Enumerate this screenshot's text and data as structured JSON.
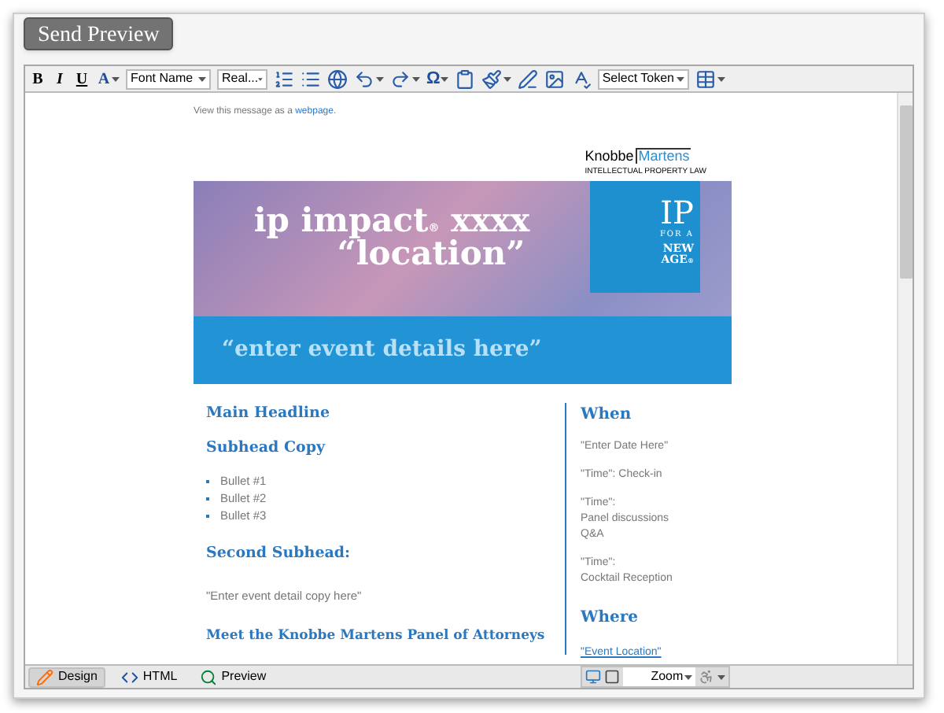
{
  "send_button": "Send Preview",
  "toolbar": {
    "format_buttons": [
      {
        "label": "B",
        "kind": "bold"
      },
      {
        "label": "I",
        "kind": "italic"
      },
      {
        "label": "U",
        "kind": "underline"
      },
      {
        "label": "A",
        "kind": "color"
      }
    ],
    "font_name": "Font Name",
    "font_size": "Real...",
    "symbol": "Ω",
    "token": "Select Token"
  },
  "email": {
    "view_text": "View this message as a ",
    "view_link": "webpage",
    "view_end": ".",
    "logo": {
      "left": "Knobbe",
      "right": "Martens",
      "tagline": "INTELLECTUAL PROPERTY LAW"
    },
    "banner": {
      "title": "ip impact",
      "reg": "®",
      "title_rest": " xxxx",
      "location": "“location”",
      "badge": [
        "IP",
        "FOR A",
        "NEW",
        "AGE"
      ],
      "badge_mark": "®",
      "details": "“enter event details here”"
    },
    "left": {
      "headline": "Main Headline",
      "subhead": "Subhead Copy",
      "bullets": [
        "Bullet #1",
        "Bullet #2",
        "Bullet #3"
      ],
      "second_subhead": "Second Subhead:",
      "copy": "\"Enter event detail copy here\"",
      "meet": "Meet the Knobbe Martens Panel of Attorneys"
    },
    "right": {
      "when": "When",
      "items": [
        [
          "\"Enter Date Here\""
        ],
        [
          "\"Time\": Check-in"
        ],
        [
          "\"Time\":",
          "Panel discussions",
          "Q&A"
        ],
        [
          "\"Time\":",
          "Cocktail Reception"
        ]
      ],
      "where": "Where",
      "location_link": "\"Event Location\""
    }
  },
  "modes": [
    {
      "label": "Design",
      "kind": "design",
      "selected": true
    },
    {
      "label": "HTML",
      "kind": "html",
      "selected": false
    },
    {
      "label": "Preview",
      "kind": "preview",
      "selected": false
    }
  ],
  "zoom": "Zoom"
}
